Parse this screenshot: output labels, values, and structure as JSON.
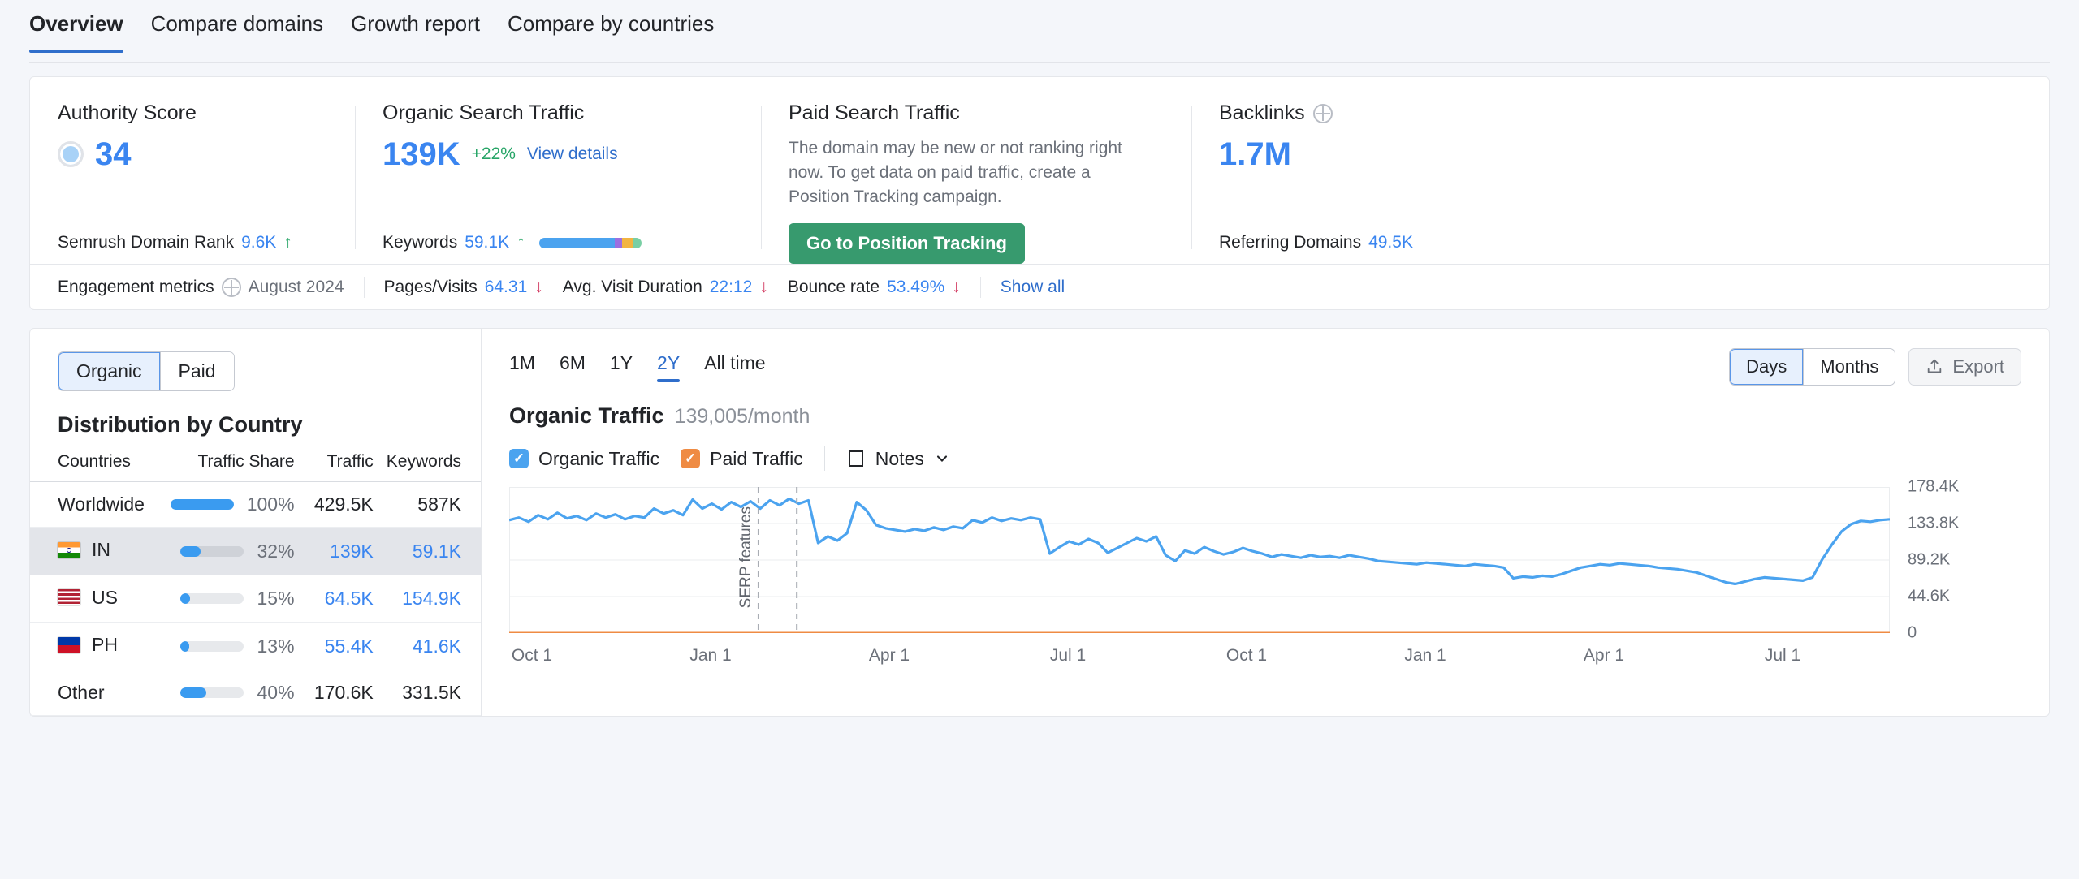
{
  "tabs": [
    {
      "label": "Overview",
      "active": true
    },
    {
      "label": "Compare domains",
      "active": false
    },
    {
      "label": "Growth report",
      "active": false
    },
    {
      "label": "Compare by countries",
      "active": false
    }
  ],
  "kpis": {
    "authority": {
      "title": "Authority Score",
      "value": "34",
      "footer_label": "Semrush Domain Rank",
      "footer_value": "9.6K",
      "footer_trend": "↑"
    },
    "organic": {
      "title": "Organic Search Traffic",
      "value": "139K",
      "delta": "+22%",
      "link": "View details",
      "footer_label": "Keywords",
      "footer_value": "59.1K",
      "footer_trend": "↑",
      "bar_segments": [
        {
          "color": "#4ba3ef",
          "pct": 74
        },
        {
          "color": "#9b6fe0",
          "pct": 7
        },
        {
          "color": "#f2b441",
          "pct": 11
        },
        {
          "color": "#79cfa4",
          "pct": 8
        }
      ]
    },
    "paid": {
      "title": "Paid Search Traffic",
      "description": "The domain may be new or not ranking right now. To get data on paid traffic, create a Position Tracking campaign.",
      "button": "Go to Position Tracking"
    },
    "backlinks": {
      "title": "Backlinks",
      "value": "1.7M",
      "footer_label": "Referring Domains",
      "footer_value": "49.5K"
    }
  },
  "engagement": {
    "label": "Engagement metrics",
    "period": "August 2024",
    "metrics": [
      {
        "label": "Pages/Visits",
        "value": "64.31",
        "trend": "↓"
      },
      {
        "label": "Avg. Visit Duration",
        "value": "22:12",
        "trend": "↓"
      },
      {
        "label": "Bounce rate",
        "value": "53.49%",
        "trend": "↓"
      }
    ],
    "show_all": "Show all"
  },
  "left_panel": {
    "toggle": [
      {
        "label": "Organic",
        "active": true
      },
      {
        "label": "Paid",
        "active": false
      }
    ],
    "title": "Distribution by Country",
    "columns": [
      "Countries",
      "Traffic Share",
      "Traffic",
      "Keywords"
    ],
    "rows": [
      {
        "country": "Worldwide",
        "flag": "",
        "share_pct": 100,
        "share": "100%",
        "traffic": "429.5K",
        "keywords": "587K",
        "highlight": false,
        "linked": false
      },
      {
        "country": "IN",
        "flag": "in",
        "share_pct": 32,
        "share": "32%",
        "traffic": "139K",
        "keywords": "59.1K",
        "highlight": true,
        "linked": true
      },
      {
        "country": "US",
        "flag": "us",
        "share_pct": 15,
        "share": "15%",
        "traffic": "64.5K",
        "keywords": "154.9K",
        "highlight": false,
        "linked": true
      },
      {
        "country": "PH",
        "flag": "ph",
        "share_pct": 13,
        "share": "13%",
        "traffic": "55.4K",
        "keywords": "41.6K",
        "highlight": false,
        "linked": true
      },
      {
        "country": "Other",
        "flag": "",
        "share_pct": 40,
        "share": "40%",
        "traffic": "170.6K",
        "keywords": "331.5K",
        "highlight": false,
        "linked": false
      }
    ]
  },
  "chart_panel": {
    "ranges": [
      {
        "label": "1M",
        "active": false
      },
      {
        "label": "6M",
        "active": false
      },
      {
        "label": "1Y",
        "active": false
      },
      {
        "label": "2Y",
        "active": true
      },
      {
        "label": "All time",
        "active": false
      }
    ],
    "granularity": [
      {
        "label": "Days",
        "active": true
      },
      {
        "label": "Months",
        "active": false
      }
    ],
    "export_label": "Export",
    "title": "Organic Traffic",
    "subtitle": "139,005/month",
    "legend": [
      {
        "label": "Organic Traffic",
        "color": "#4ba3ef",
        "checked": true
      },
      {
        "label": "Paid Traffic",
        "color": "#ef8b43",
        "checked": true
      }
    ],
    "notes_label": "Notes"
  },
  "chart_data": {
    "type": "line",
    "title": "Organic Traffic",
    "subtitle": "139,005/month",
    "xlabel": "",
    "ylabel": "",
    "ylim": [
      0,
      178400
    ],
    "ytick_labels": [
      "178.4K",
      "133.8K",
      "89.2K",
      "44.6K",
      "0"
    ],
    "ytick_values": [
      178400,
      133800,
      89200,
      44600,
      0
    ],
    "xtick_labels": [
      "Oct 1",
      "Jan 1",
      "Apr 1",
      "Jul 1",
      "Oct 1",
      "Jan 1",
      "Apr 1",
      "Jul 1"
    ],
    "grid": true,
    "legend_position": "top-left",
    "annotations": [
      {
        "label": "SERP features",
        "type": "vertical-dashed-line",
        "x_index": 26
      },
      {
        "label": "",
        "type": "vertical-dashed-line",
        "x_index": 30
      }
    ],
    "series": [
      {
        "name": "Organic Traffic",
        "color": "#4ba3ef",
        "values": [
          138000,
          141000,
          136000,
          144000,
          139000,
          147000,
          140000,
          143000,
          138000,
          146000,
          141000,
          145000,
          139000,
          143000,
          141000,
          152000,
          146000,
          150000,
          144000,
          163000,
          152000,
          158000,
          151000,
          160000,
          154000,
          161000,
          152000,
          162000,
          156000,
          164000,
          158000,
          162000,
          110000,
          118000,
          113000,
          122000,
          160000,
          150000,
          132000,
          128000,
          126000,
          124000,
          127000,
          125000,
          129000,
          126000,
          130000,
          128000,
          138000,
          135000,
          141000,
          137000,
          140000,
          138000,
          141000,
          139000,
          97000,
          105000,
          112000,
          108000,
          115000,
          110000,
          98000,
          104000,
          110000,
          116000,
          112000,
          118000,
          95000,
          88000,
          101000,
          97000,
          105000,
          100000,
          96000,
          99000,
          104000,
          100000,
          97000,
          93000,
          96000,
          94000,
          92000,
          95000,
          93000,
          94000,
          92000,
          95000,
          93000,
          91000,
          88000,
          87000,
          86000,
          85000,
          84000,
          86000,
          85000,
          84000,
          83000,
          82000,
          84000,
          83000,
          82000,
          80000,
          67000,
          69000,
          68000,
          70000,
          69000,
          72000,
          76000,
          80000,
          82000,
          84000,
          83000,
          85000,
          84000,
          83000,
          82000,
          80000,
          79000,
          78000,
          76000,
          74000,
          70000,
          66000,
          62000,
          60000,
          63000,
          66000,
          68000,
          67000,
          66000,
          65000,
          64000,
          68000,
          90000,
          108000,
          124000,
          133000,
          137000,
          136000,
          138000,
          139000
        ]
      },
      {
        "name": "Paid Traffic",
        "color": "#ef8b43",
        "values": [
          0,
          0,
          0,
          0,
          0,
          0,
          0,
          0,
          0,
          0,
          0,
          0,
          0,
          0,
          0,
          0,
          0,
          0,
          0,
          0,
          0,
          0,
          0,
          0,
          0,
          0,
          0,
          0,
          0,
          0,
          0,
          0,
          0,
          0,
          0,
          0,
          0,
          0,
          0,
          0,
          0,
          0,
          0,
          0,
          0,
          0,
          0,
          0,
          0,
          0,
          0,
          0,
          0,
          0,
          0,
          0,
          0,
          0,
          0,
          0,
          0,
          0,
          0,
          0,
          0,
          0,
          0,
          0,
          0,
          0,
          0,
          0,
          0,
          0,
          0,
          0,
          0,
          0,
          0,
          0,
          0,
          0,
          0,
          0,
          0,
          0,
          0,
          0,
          0,
          0,
          0,
          0,
          0,
          0,
          0,
          0,
          0,
          0,
          0,
          0,
          0,
          0,
          0,
          0,
          0,
          0,
          0,
          0,
          0,
          0,
          0,
          0,
          0,
          0,
          0,
          0,
          0,
          0,
          0,
          0,
          0,
          0,
          0,
          0,
          0,
          0,
          0,
          0,
          0,
          0,
          0,
          0,
          0,
          0,
          0,
          0,
          0,
          0,
          0,
          0,
          0,
          0,
          0,
          0
        ]
      }
    ]
  }
}
